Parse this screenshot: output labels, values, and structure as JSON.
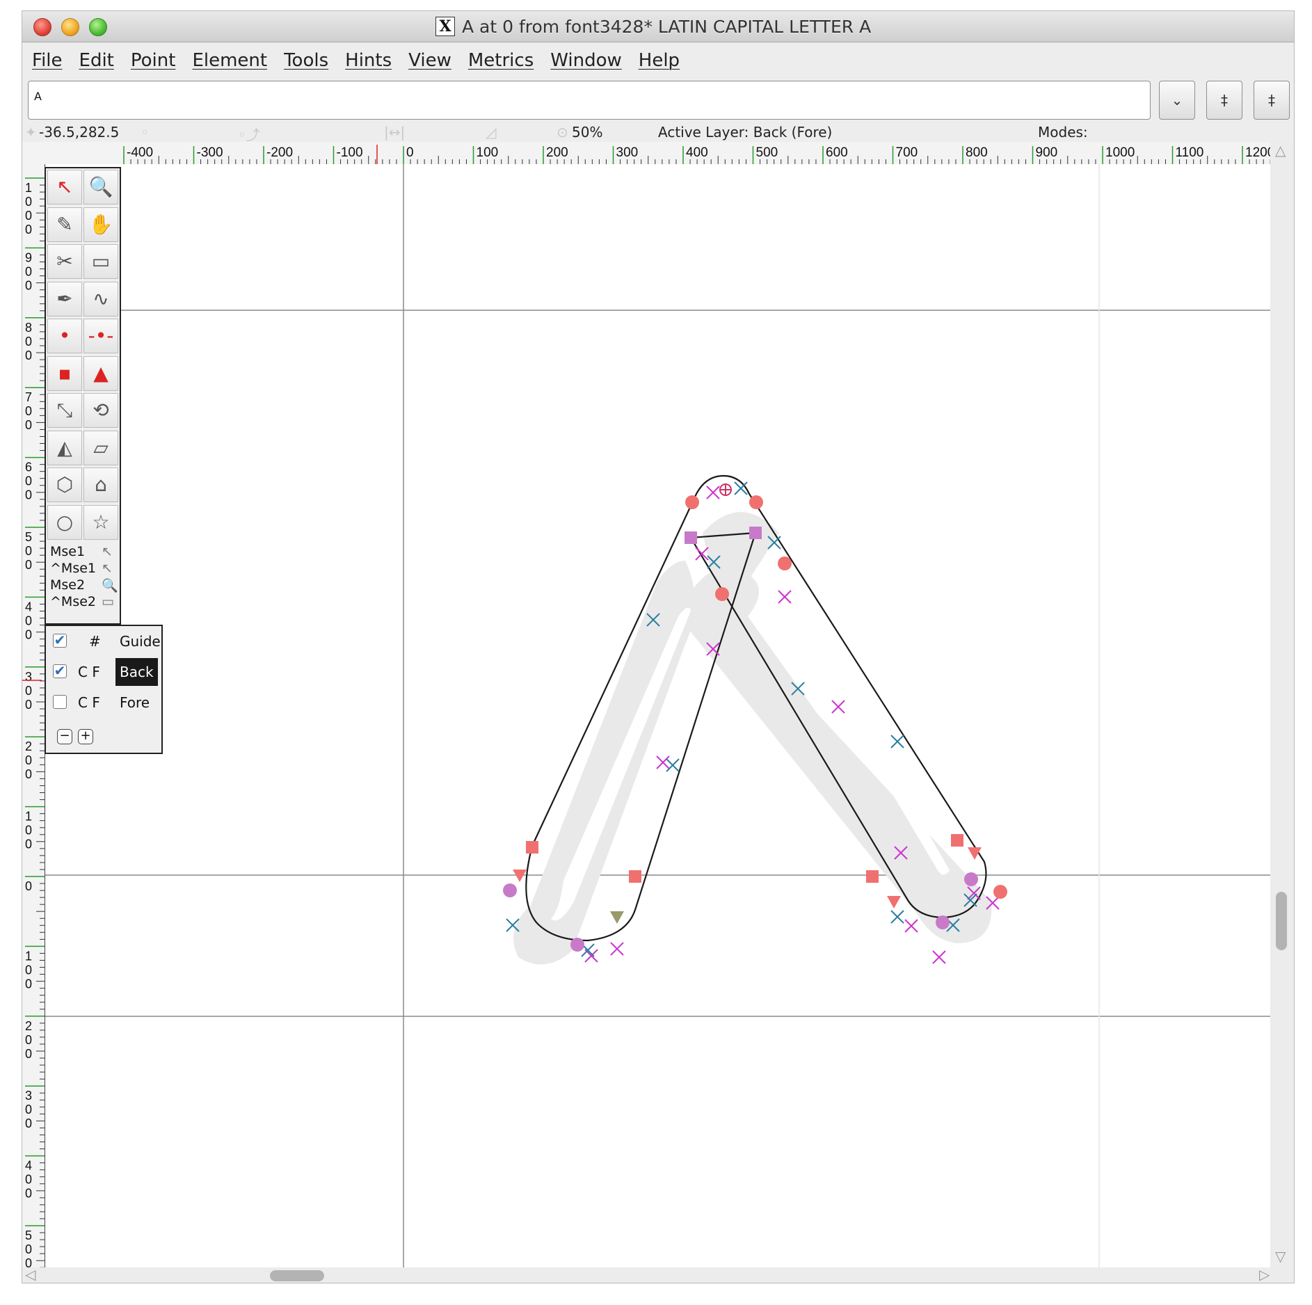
{
  "window": {
    "title": "A at 0 from font3428* LATIN CAPITAL LETTER A",
    "x_icon": "X"
  },
  "menu": [
    "File",
    "Edit",
    "Point",
    "Element",
    "Tools",
    "Hints",
    "View",
    "Metrics",
    "Window",
    "Help"
  ],
  "glyph_field": {
    "value": "A",
    "buttons": [
      "⌄",
      "‡",
      "‡"
    ]
  },
  "info": {
    "coords": "-36.5,282.5",
    "zoom": "50%",
    "active_layer": "Active Layer: Back (Fore)",
    "modes": "Modes:"
  },
  "ruler": {
    "h_labels": [
      "-400",
      "-300",
      "-200",
      "-100",
      "0",
      "100",
      "200",
      "300",
      "400",
      "500",
      "600",
      "700",
      "800",
      "900",
      "1000",
      "1100",
      "1200"
    ],
    "v_labels": [
      "1000",
      "900",
      "800",
      "700",
      "600",
      "500",
      "400",
      "300",
      "200",
      "100",
      "0",
      "100",
      "200",
      "300",
      "400",
      "500"
    ]
  },
  "tools": {
    "icons": [
      "pointer-icon",
      "magnify-icon",
      "freehand-icon",
      "scroll-hand-icon",
      "knife-icon",
      "ruler-icon",
      "pen-icon",
      "spiro-icon",
      "curve-point-icon",
      "hv-curve-point-icon",
      "corner-point-icon",
      "tangent-point-icon",
      "scale-icon",
      "rotate-icon",
      "flip-icon",
      "skew-icon",
      "3d-rotate-icon",
      "perspective-icon",
      "ellipse-icon",
      "star-icon"
    ],
    "glyphs": [
      "↖",
      "🔍",
      "✎",
      "✋",
      "✂",
      "▭",
      "✒",
      "∿",
      "•",
      "-•-",
      "▪",
      "▲",
      "⤡",
      "⟲",
      "◭",
      "▱",
      "⬡",
      "⌂",
      "○",
      "☆"
    ],
    "mouse": [
      "Mse1",
      "^Mse1",
      "Mse2",
      "^Mse2"
    ]
  },
  "layers": {
    "rows": [
      {
        "checked": true,
        "flags": "#",
        "name": "Guide",
        "active": false
      },
      {
        "checked": true,
        "flags": "C F",
        "name": "Back",
        "active": true
      },
      {
        "checked": false,
        "flags": "C F",
        "name": "Fore",
        "active": false
      }
    ],
    "minus": "−",
    "plus": "+"
  },
  "glyph": {
    "outline_color": "#1a1a1a",
    "fill_color": "#e8e8e8",
    "point_colors": {
      "magenta": "#cc33cc",
      "teal": "#2a7fa0",
      "red": "#f07070",
      "purple": "#c87ac8"
    }
  }
}
